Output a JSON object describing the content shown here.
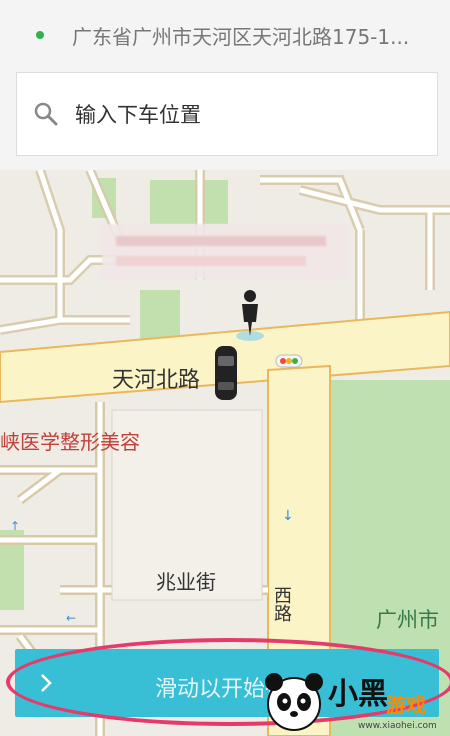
{
  "pickup": {
    "address": "广东省广州市天河区天河北路175-1..."
  },
  "search": {
    "placeholder": "输入下车位置"
  },
  "map": {
    "road_main": "天河北路",
    "poi": "峡医学整形美容",
    "street": "兆业街",
    "road_vertical": "西路",
    "district": "广州市"
  },
  "slider": {
    "label": "滑动以开始行"
  },
  "watermark": {
    "brand": "小黑游戏",
    "url": "www.xiaohei.com"
  },
  "colors": {
    "accent": "#38bfd6",
    "highlight": "#e53a6a",
    "road_yellow": "#fbf4c6",
    "park_green": "#bfe0b0"
  }
}
